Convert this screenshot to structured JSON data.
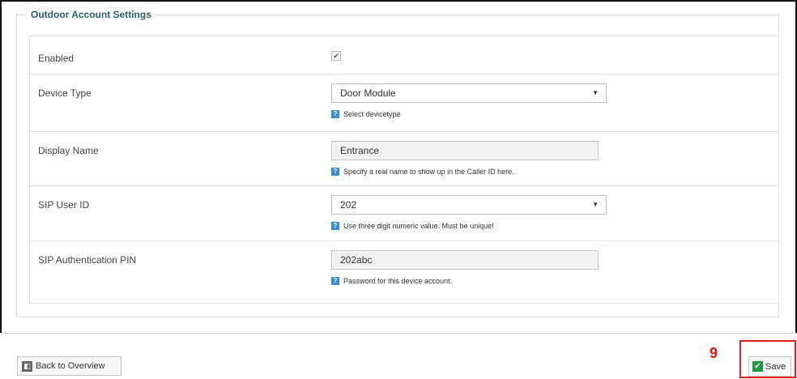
{
  "section": {
    "legend": "Outdoor Account Settings"
  },
  "fields": {
    "enabled": {
      "label": "Enabled",
      "checked": "✔"
    },
    "device_type": {
      "label": "Device Type",
      "value": "Door Module",
      "help": "Select devicetype"
    },
    "display_name": {
      "label": "Display Name",
      "value": "Entrance",
      "help": "Specify a real name to show up in the Caller ID here."
    },
    "sip_user_id": {
      "label": "SIP User ID",
      "value": "202",
      "help": "Use three digit numeric value. Must be unique!"
    },
    "sip_pin": {
      "label": "SIP Authentication PIN",
      "value": "202abc",
      "help": "Password for this device account."
    }
  },
  "footer": {
    "back_label": "Back to Overview",
    "save_label": "Save",
    "step_number": "9"
  },
  "icons": {
    "dropdown": "▼",
    "help": "?",
    "back": "◧",
    "save": "✔"
  },
  "colors": {
    "legend": "#2e5f6a",
    "highlight": "#e21b1b",
    "save_icon": "#1c9b42",
    "help_icon": "#3a8fd1"
  }
}
